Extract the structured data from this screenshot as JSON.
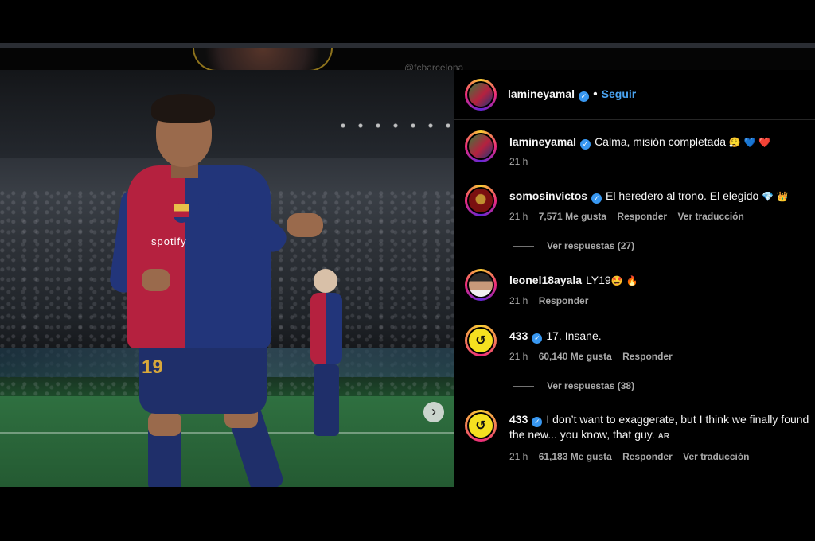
{
  "background": {
    "handle_hint": "@fcbarcelona"
  },
  "post": {
    "author": "lamineyamal",
    "follow_label": "Seguir",
    "photo": {
      "sponsor": "spotify",
      "number": "19",
      "next_arrow": "›"
    }
  },
  "comments": [
    {
      "user": "lamineyamal",
      "text": "Calma, misión completada",
      "emojis": "😮‍💨 💙 ❤️",
      "time": "21 h"
    },
    {
      "user": "somosinvictos",
      "text": "El heredero al trono. El elegido",
      "emojis": "💎 👑",
      "time": "21 h",
      "likes": "7,571 Me gusta",
      "reply": "Responder",
      "translate": "Ver traducción",
      "replies": "Ver respuestas (27)"
    },
    {
      "user": "leonel18ayala",
      "text": "LY19",
      "emojis": "🤩 🔥",
      "time": "21 h",
      "reply": "Responder"
    },
    {
      "user": "433",
      "text": "17. Insane.",
      "time": "21 h",
      "likes": "60,140 Me gusta",
      "reply": "Responder",
      "replies": "Ver respuestas (38)"
    },
    {
      "user": "433",
      "text": "I don’t want to exaggerate, but I think we finally found",
      "text2": "the new... you know, that guy.",
      "ar": "AR",
      "time": "21 h",
      "likes": "61,183 Me gusta",
      "reply": "Responder",
      "translate": "Ver traducción"
    }
  ],
  "colors": {
    "verified": "#3897f0",
    "follow": "#4aa3f0",
    "meta": "#a8a8a8"
  }
}
